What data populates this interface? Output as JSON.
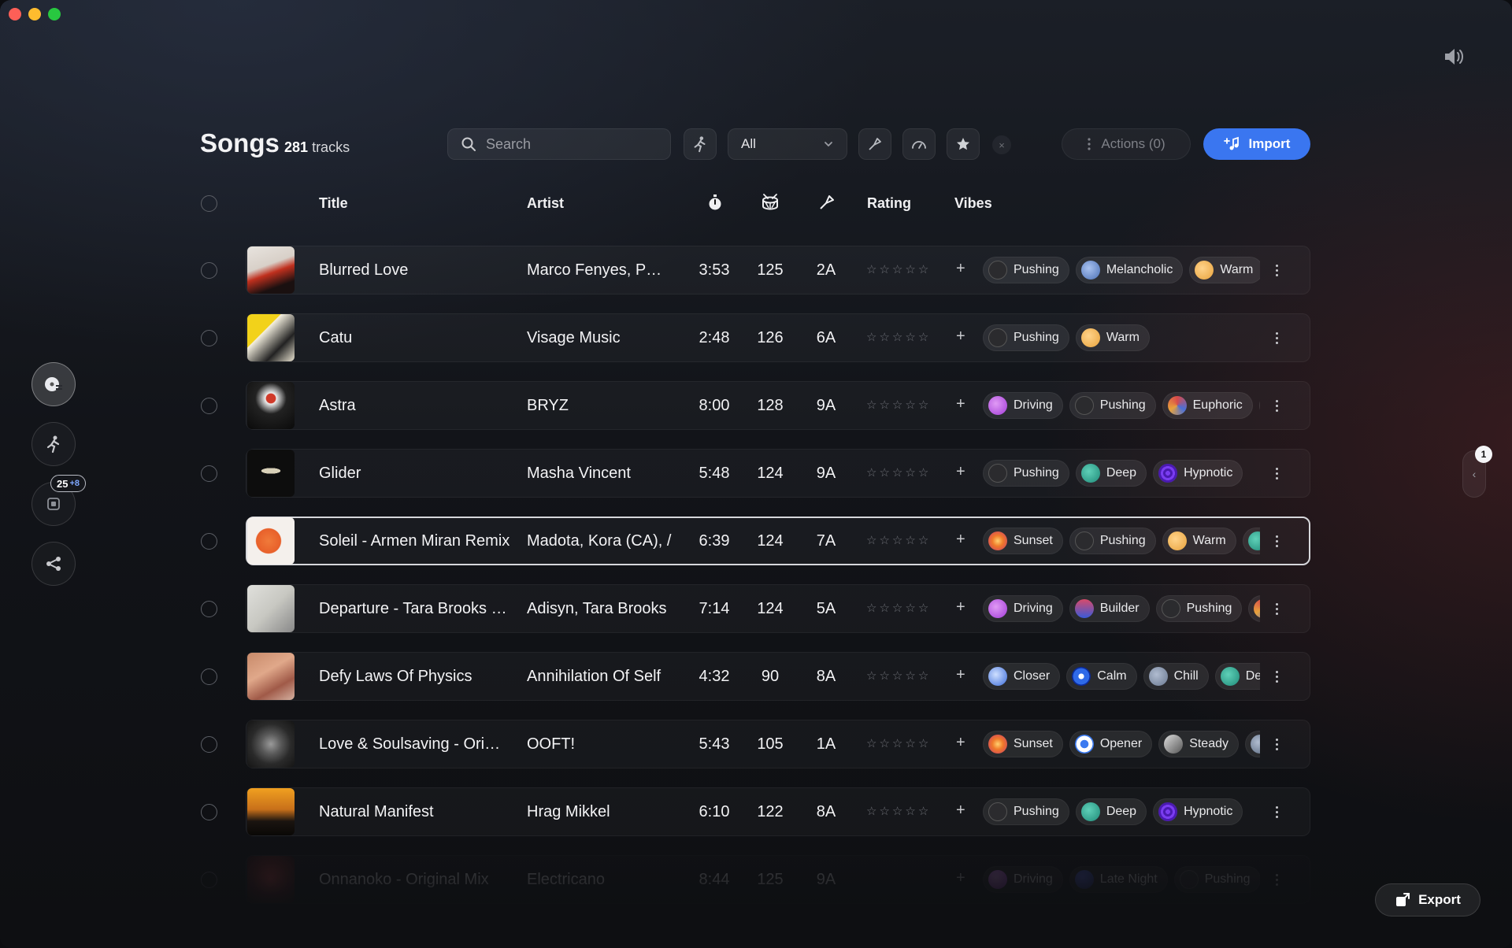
{
  "window": {
    "controls": [
      "close",
      "minimize",
      "zoom"
    ]
  },
  "header": {
    "title": "Songs",
    "count": "281",
    "count_suffix": "tracks"
  },
  "search": {
    "placeholder": "Search",
    "value": ""
  },
  "filter": {
    "selected": "All"
  },
  "toolbar": {
    "clear_label": "×",
    "actions_label": "Actions (0)",
    "import_label": "Import"
  },
  "sidebar": {
    "badge_count": "25",
    "badge_extra": "+8"
  },
  "columns": {
    "title": "Title",
    "artist": "Artist",
    "rating": "Rating",
    "vibes": "Vibes"
  },
  "tracks": [
    {
      "title": "Blurred Love",
      "artist": "Marco Fenyes, P…",
      "time": "3:53",
      "bpm": "125",
      "key": "2A",
      "vibes": [
        "Pushing",
        "Melancholic",
        "Warm"
      ]
    },
    {
      "title": "Catu",
      "artist": "Visage Music",
      "time": "2:48",
      "bpm": "126",
      "key": "6A",
      "vibes": [
        "Pushing",
        "Warm"
      ]
    },
    {
      "title": "Astra",
      "artist": "BRYZ",
      "time": "8:00",
      "bpm": "128",
      "key": "9A",
      "vibes": [
        "Driving",
        "Pushing",
        "Euphoric",
        ""
      ]
    },
    {
      "title": "Glider",
      "artist": "Masha Vincent",
      "time": "5:48",
      "bpm": "124",
      "key": "9A",
      "vibes": [
        "Pushing",
        "Deep",
        "Hypnotic"
      ]
    },
    {
      "title": "Soleil - Armen Miran Remix",
      "artist": "Madota, Kora (CA), /",
      "time": "6:39",
      "bpm": "124",
      "key": "7A",
      "vibes": [
        "Sunset",
        "Pushing",
        "Warm",
        ""
      ]
    },
    {
      "title": "Departure - Tara Brooks …",
      "artist": "Adisyn, Tara Brooks",
      "time": "7:14",
      "bpm": "124",
      "key": "5A",
      "vibes": [
        "Driving",
        "Builder",
        "Pushing",
        ""
      ]
    },
    {
      "title": "Defy Laws Of Physics",
      "artist": "Annihilation Of Self",
      "time": "4:32",
      "bpm": "90",
      "key": "8A",
      "vibes": [
        "Closer",
        "Calm",
        "Chill",
        "Deep"
      ]
    },
    {
      "title": "Love & Soulsaving - Ori…",
      "artist": "OOFT!",
      "time": "5:43",
      "bpm": "105",
      "key": "1A",
      "vibes": [
        "Sunset",
        "Opener",
        "Steady",
        ""
      ]
    },
    {
      "title": "Natural Manifest",
      "artist": "Hrag Mikkel",
      "time": "6:10",
      "bpm": "122",
      "key": "8A",
      "vibes": [
        "Pushing",
        "Deep",
        "Hypnotic"
      ]
    },
    {
      "title": "Onnanoko - Original Mix",
      "artist": "Electricano",
      "time": "8:44",
      "bpm": "125",
      "key": "9A",
      "vibes": [
        "Driving",
        "Late Night",
        "Pushing"
      ]
    }
  ],
  "vibe_colors": {
    "Pushing": "#2b2b2e",
    "Melancholic": "#4a6fb5",
    "Warm": "#e8a23c",
    "Driving": "#a13ad6",
    "Euphoric": "#d84a4a",
    "Deep": "#1f8a78",
    "Hypnotic": "#7a3cf0",
    "Sunset": "#f07a2a",
    "Builder": "#c84060",
    "Closer": "#3a6ad8",
    "Calm": "#2f6ae8",
    "Chill": "#6a7890",
    "Opener": "#3b7af0",
    "Steady": "#8a8c92",
    "Late Night": "#2a3a8a",
    "": "#5a6a80"
  },
  "pager": {
    "badge": "1"
  },
  "export": {
    "label": "Export"
  }
}
